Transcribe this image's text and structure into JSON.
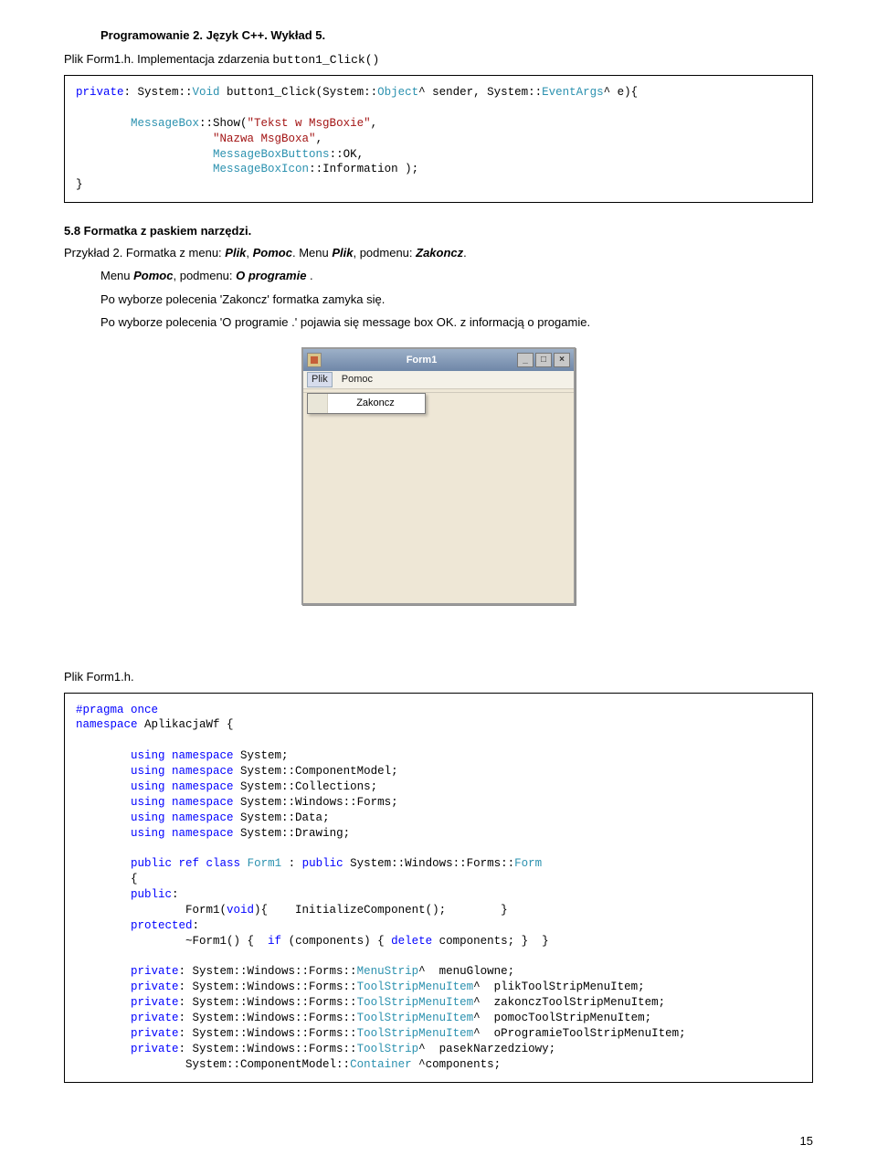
{
  "header": "Programowanie 2. Język C++. Wykład 5.",
  "file_label_1": "Plik Form1.h. Implementacja zdarzenia ",
  "file_label_1_code": "button1_Click()",
  "codebox1": {
    "l1a": "private",
    "l1b": ": System::",
    "l1c": "Void",
    "l1d": " button1_Click(System::",
    "l1e": "Object",
    "l1f": "^ sender, System::",
    "l1g": "EventArgs",
    "l1h": "^ e){",
    "l2a": "        ",
    "l2b": "MessageBox",
    "l2c": "::Show(",
    "l2d": "\"Tekst w MsgBoxie\"",
    "l2e": ",",
    "l3a": "                    ",
    "l3b": "\"Nazwa MsgBoxa\"",
    "l3c": ",",
    "l4a": "                    ",
    "l4b": "MessageBoxButtons",
    "l4c": "::OK,",
    "l5a": "                    ",
    "l5b": "MessageBoxIcon",
    "l5c": "::Information );",
    "l6": "}"
  },
  "section58": "5.8 Formatka z paskiem narzędzi.",
  "ex2_prefix": "Przykład 2. Formatka z menu: ",
  "ex2_plik": "Plik",
  "ex2_comma": ", ",
  "ex2_pomoc": "Pomoc",
  "ex2_m1": ". Menu ",
  "ex2_plik2": "Plik",
  "ex2_m2": ", podmenu: ",
  "ex2_zak": "Zakoncz",
  "ex2_dot": ".",
  "ex2_l2_a": "Menu ",
  "ex2_l2_pomoc": "Pomoc",
  "ex2_l2_b": ", podmenu: ",
  "ex2_l2_oprog": "O programie",
  "ex2_l2_dot": " .",
  "ex2_l3": "Po wyborze polecenia 'Zakoncz' formatka zamyka się.",
  "ex2_l4": "Po wyborze polecenia 'O programie .' pojawia się message box OK. z informacją o progamie.",
  "form1": {
    "title": "Form1",
    "menu": {
      "plik": "Plik",
      "pomoc": "Pomoc",
      "zakoncz": "Zakoncz"
    },
    "min": "_",
    "max": "□",
    "close": "×"
  },
  "file_label_2": "Plik Form1.h.",
  "codebox2": {
    "pragma": "#pragma once",
    "ns_kw": "namespace",
    "ns_name": " AplikacjaWf {",
    "u_kw": "using namespace",
    "u1": " System;",
    "u2": " System::ComponentModel;",
    "u3": " System::Collections;",
    "u4": " System::Windows::Forms;",
    "u5": " System::Data;",
    "u6": " System::Drawing;",
    "cls_a": "public ref class",
    "cls_b_pre": " ",
    "cls_b": "Form1",
    "cls_c": " : ",
    "cls_d": "public",
    "cls_e": " System::Windows::Forms::",
    "cls_f": "Form",
    "brace_open": "        {",
    "pub": "public",
    "pub_colon": ":",
    "ctor_a": "                Form1(",
    "ctor_b": "void",
    "ctor_c": "){    InitializeComponent();        }",
    "prot": "protected",
    "prot_colon": ":",
    "dtor_a": "                ~Form1() {  ",
    "dtor_b": "if",
    "dtor_c": " (components) { ",
    "dtor_d": "delete",
    "dtor_e": " components; }  }",
    "p1a": "private",
    "p1b": ": System::Windows::Forms::",
    "p1c": "MenuStrip",
    "p1d": "^  menuGlowne;",
    "p2a": "private",
    "p2b": ": System::Windows::Forms::",
    "p2c": "ToolStripMenuItem",
    "p2d": "^  plikToolStripMenuItem;",
    "p3a": "private",
    "p3b": ": System::Windows::Forms::",
    "p3c": "ToolStripMenuItem",
    "p3d": "^  zakonczToolStripMenuItem;",
    "p4a": "private",
    "p4b": ": System::Windows::Forms::",
    "p4c": "ToolStripMenuItem",
    "p4d": "^  pomocToolStripMenuItem;",
    "p5a": "private",
    "p5b": ": System::Windows::Forms::",
    "p5c": "ToolStripMenuItem",
    "p5d": "^  oProgramieToolStripMenuItem;",
    "p6a": "private",
    "p6b": ": System::Windows::Forms::",
    "p6c": "ToolStrip",
    "p6d": "^  pasekNarzedziowy;",
    "p7a": "                System::ComponentModel::",
    "p7b": "Container",
    "p7c": " ^components;"
  },
  "page_number": "15"
}
